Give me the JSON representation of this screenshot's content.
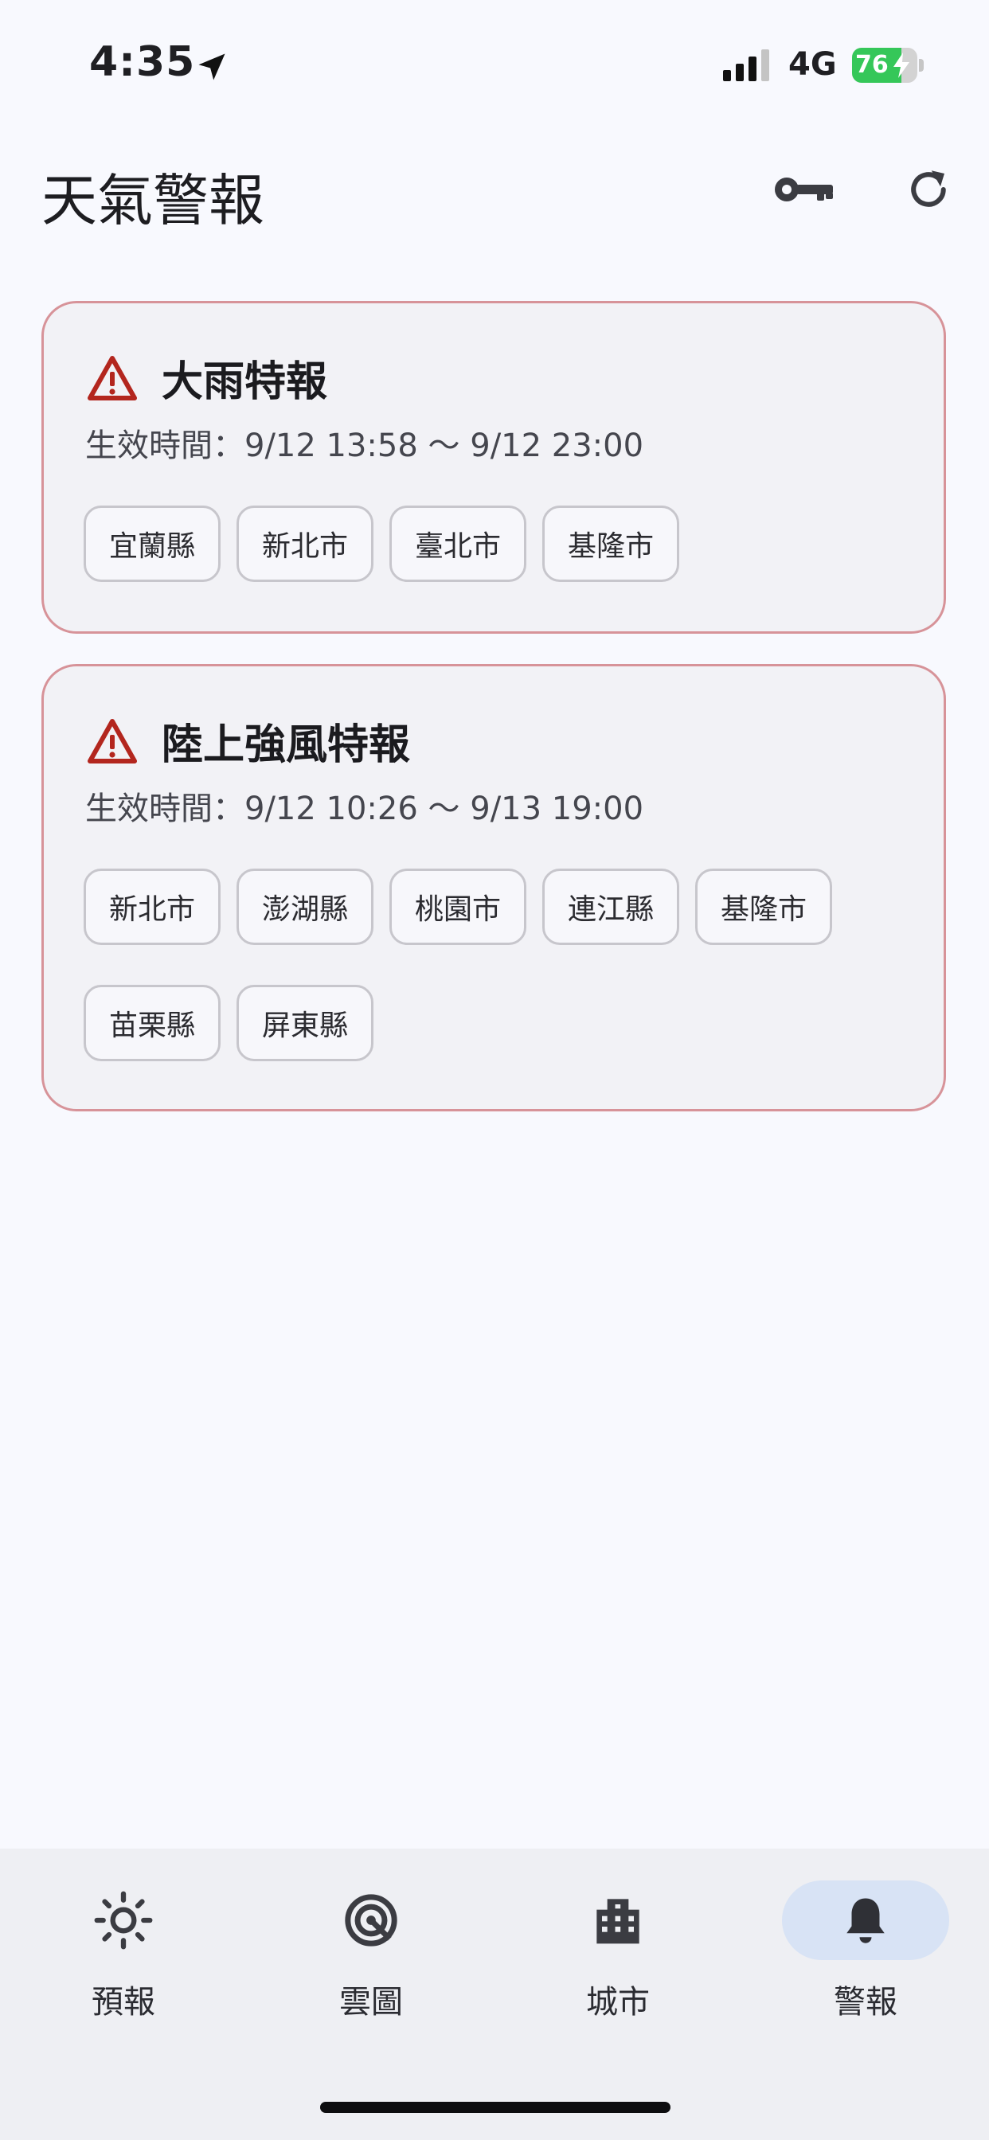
{
  "status_bar": {
    "time": "4:35",
    "network": "4G",
    "battery_percent": "76",
    "battery_level": 0.76,
    "battery_color": "#35c759"
  },
  "header": {
    "title": "天氣警報",
    "key_icon": "key-icon",
    "refresh_icon": "refresh-icon"
  },
  "alerts": [
    {
      "icon": "warning-icon",
      "title": "大雨特報",
      "time": "生效時間：9/12 13:58 ～ 9/12 23:00",
      "areas": [
        "宜蘭縣",
        "新北市",
        "臺北市",
        "基隆市"
      ]
    },
    {
      "icon": "warning-icon",
      "title": "陸上強風特報",
      "time": "生效時間：9/12 10:26 ～ 9/13 19:00",
      "areas": [
        "新北市",
        "澎湖縣",
        "桃園市",
        "連江縣",
        "基隆市",
        "苗栗縣",
        "屏東縣"
      ]
    }
  ],
  "colors": {
    "alert_border": "#d79399",
    "warning_icon": "#b3261e",
    "nav_active_bg": "#d8e3f5"
  },
  "nav": {
    "items": [
      {
        "label": "預報",
        "icon": "sun-icon"
      },
      {
        "label": "雲圖",
        "icon": "radar-icon"
      },
      {
        "label": "城市",
        "icon": "city-icon"
      },
      {
        "label": "警報",
        "icon": "bell-icon",
        "active": true
      }
    ]
  }
}
